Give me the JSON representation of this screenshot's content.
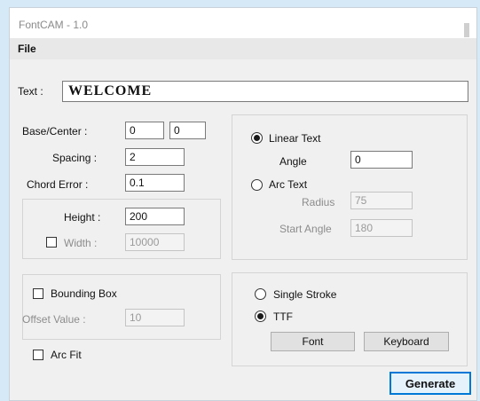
{
  "window": {
    "title": "FontCAM - 1.0"
  },
  "menu": {
    "file": "File"
  },
  "text_field": {
    "label": "Text :",
    "value": "WELCOME"
  },
  "base_center": {
    "label": "Base/Center :",
    "x": "0",
    "y": "0"
  },
  "spacing": {
    "label": "Spacing :",
    "value": "2"
  },
  "chord_error": {
    "label": "Chord Error :",
    "value": "0.1"
  },
  "height": {
    "label": "Height :",
    "value": "200"
  },
  "width": {
    "label": "Width :",
    "value": "10000",
    "checked": false
  },
  "bounding_box": {
    "label": "Bounding Box",
    "checked": false
  },
  "offset_value": {
    "label": "Offset Value :",
    "value": "10"
  },
  "arc_fit": {
    "label": "Arc Fit",
    "checked": false
  },
  "text_mode": {
    "linear_label": "Linear Text",
    "linear_selected": true,
    "angle_label": "Angle",
    "angle_value": "0",
    "arc_label": "Arc Text",
    "arc_selected": false,
    "radius_label": "Radius",
    "radius_value": "75",
    "start_angle_label": "Start Angle",
    "start_angle_value": "180"
  },
  "font_mode": {
    "single_stroke_label": "Single Stroke",
    "single_stroke_selected": false,
    "ttf_label": "TTF",
    "ttf_selected": true
  },
  "buttons": {
    "font": "Font",
    "keyboard": "Keyboard",
    "generate": "Generate"
  }
}
